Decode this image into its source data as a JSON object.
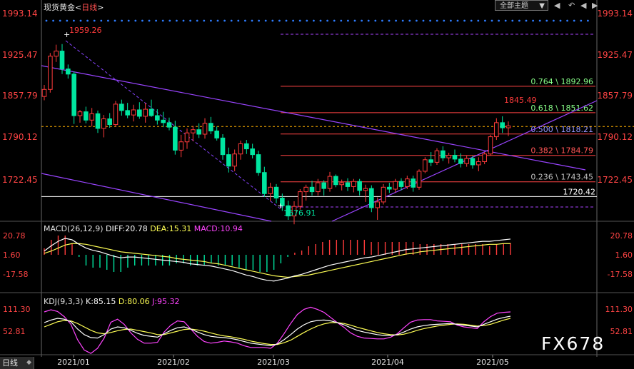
{
  "header": {
    "instrument": "现货黄金",
    "timeframe": "日线"
  },
  "toolbar": {
    "theme_label": "全部主题",
    "theme_arrow": "▼",
    "nav_first": "◀",
    "nav_back": "↶",
    "nav_prev": "◀",
    "nav_next": "▶"
  },
  "bottom_tab": {
    "label": "日线",
    "arrow": "◆"
  },
  "watermark": "FX678",
  "macd": {
    "title": "MACD(26,12,9)",
    "diff": "DIFF:20.78",
    "dea": "DEA:15.31",
    "macd": "MACD:10.94"
  },
  "kdj": {
    "title": "KDJ(9,3,3)",
    "k": "K:85.15",
    "d": "D:80.06",
    "j": "J:95.32"
  },
  "colors": {
    "up": "#ff3b3b",
    "down": "#00e6a0",
    "diff": "#ffffff",
    "dea": "#ffff55",
    "macd_pos": "#ff3b3b",
    "macd_neg": "#00e6a0",
    "k": "#ffffff",
    "d": "#ffff55",
    "j": "#ff44ff",
    "trend": "#9944ff",
    "fib": "#cc3333",
    "current": "#ffb000"
  },
  "chart_data": {
    "type": "candlestick",
    "price_axis_labels": [
      "1993.14",
      "1925.47",
      "1857.79",
      "1790.12",
      "1722.45"
    ],
    "time_axis_labels": [
      "2021/01",
      "2021/02",
      "2021/03",
      "2021/04",
      "2021/05"
    ],
    "ylim": [
      1665,
      2000
    ],
    "annotations": {
      "high": "1959.26",
      "low": "1676.91",
      "recent_high": "1845.49",
      "level_line": "1720.42"
    },
    "fibonacci": [
      {
        "label": "0.764 \\ 1892.96",
        "value": 1892.96,
        "color": "#88ff88"
      },
      {
        "label": "0.618 \\ 1851.62",
        "value": 1851.62,
        "color": "#88ff88"
      },
      {
        "label": "0.500 \\ 1818.21",
        "value": 1818.21,
        "color": "#9999ff"
      },
      {
        "label": "0.382 \\ 1784.79",
        "value": 1784.79,
        "color": "#ff5555"
      },
      {
        "label": "0.236 \\ 1743.45",
        "value": 1743.45,
        "color": "#c0c0c0"
      }
    ],
    "current_price": 1830,
    "candles": [
      [
        1877,
        1895,
        1871,
        1888
      ],
      [
        1888,
        1945,
        1883,
        1940
      ],
      [
        1940,
        1958,
        1931,
        1948
      ],
      [
        1948,
        1959,
        1912,
        1920
      ],
      [
        1920,
        1927,
        1905,
        1912
      ],
      [
        1912,
        1916,
        1834,
        1847
      ],
      [
        1847,
        1856,
        1836,
        1853
      ],
      [
        1853,
        1861,
        1835,
        1840
      ],
      [
        1840,
        1859,
        1830,
        1850
      ],
      [
        1850,
        1855,
        1820,
        1827
      ],
      [
        1827,
        1848,
        1813,
        1842
      ],
      [
        1842,
        1851,
        1828,
        1833
      ],
      [
        1833,
        1870,
        1830,
        1865
      ],
      [
        1865,
        1872,
        1847,
        1855
      ],
      [
        1855,
        1867,
        1843,
        1848
      ],
      [
        1848,
        1864,
        1838,
        1856
      ],
      [
        1856,
        1868,
        1842,
        1846
      ],
      [
        1846,
        1867,
        1836,
        1857
      ],
      [
        1857,
        1872,
        1845,
        1847
      ],
      [
        1847,
        1857,
        1833,
        1840
      ],
      [
        1840,
        1853,
        1829,
        1836
      ],
      [
        1836,
        1844,
        1824,
        1829
      ],
      [
        1829,
        1839,
        1786,
        1793
      ],
      [
        1793,
        1817,
        1782,
        1806
      ],
      [
        1806,
        1827,
        1795,
        1820
      ],
      [
        1820,
        1831,
        1807,
        1825
      ],
      [
        1825,
        1835,
        1812,
        1818
      ],
      [
        1818,
        1843,
        1811,
        1835
      ],
      [
        1835,
        1845,
        1818,
        1823
      ],
      [
        1823,
        1830,
        1808,
        1812
      ],
      [
        1812,
        1818,
        1778,
        1786
      ],
      [
        1786,
        1797,
        1758,
        1768
      ],
      [
        1768,
        1794,
        1760,
        1787
      ],
      [
        1787,
        1808,
        1778,
        1803
      ],
      [
        1803,
        1809,
        1787,
        1795
      ],
      [
        1795,
        1803,
        1780,
        1786
      ],
      [
        1786,
        1792,
        1753,
        1758
      ],
      [
        1758,
        1767,
        1720,
        1725
      ],
      [
        1725,
        1742,
        1713,
        1735
      ],
      [
        1735,
        1740,
        1710,
        1718
      ],
      [
        1718,
        1725,
        1698,
        1706
      ],
      [
        1706,
        1714,
        1684,
        1690
      ],
      [
        1690,
        1713,
        1677,
        1705
      ],
      [
        1705,
        1732,
        1700,
        1728
      ],
      [
        1728,
        1739,
        1714,
        1735
      ],
      [
        1735,
        1745,
        1722,
        1728
      ],
      [
        1728,
        1748,
        1722,
        1742
      ],
      [
        1742,
        1746,
        1722,
        1733
      ],
      [
        1733,
        1759,
        1728,
        1752
      ],
      [
        1752,
        1755,
        1735,
        1739
      ],
      [
        1739,
        1747,
        1730,
        1742
      ],
      [
        1742,
        1749,
        1729,
        1736
      ],
      [
        1736,
        1748,
        1727,
        1744
      ],
      [
        1744,
        1748,
        1722,
        1730
      ],
      [
        1730,
        1739,
        1712,
        1733
      ],
      [
        1733,
        1738,
        1696,
        1703
      ],
      [
        1703,
        1719,
        1684,
        1712
      ],
      [
        1712,
        1740,
        1708,
        1735
      ],
      [
        1735,
        1742,
        1726,
        1732
      ],
      [
        1732,
        1748,
        1727,
        1744
      ],
      [
        1744,
        1749,
        1730,
        1736
      ],
      [
        1736,
        1753,
        1732,
        1748
      ],
      [
        1748,
        1753,
        1728,
        1735
      ],
      [
        1735,
        1763,
        1731,
        1760
      ],
      [
        1760,
        1782,
        1757,
        1778
      ],
      [
        1778,
        1790,
        1768,
        1774
      ],
      [
        1774,
        1796,
        1770,
        1792
      ],
      [
        1792,
        1799,
        1776,
        1781
      ],
      [
        1781,
        1789,
        1772,
        1785
      ],
      [
        1785,
        1794,
        1774,
        1779
      ],
      [
        1779,
        1788,
        1766,
        1772
      ],
      [
        1772,
        1785,
        1767,
        1780
      ],
      [
        1780,
        1784,
        1764,
        1770
      ],
      [
        1770,
        1782,
        1760,
        1775
      ],
      [
        1775,
        1790,
        1771,
        1787
      ],
      [
        1787,
        1817,
        1784,
        1814
      ],
      [
        1814,
        1843,
        1809,
        1836
      ],
      [
        1836,
        1846,
        1820,
        1828
      ],
      [
        1828,
        1838,
        1815,
        1831
      ]
    ],
    "macd_series": {
      "diff": [
        5,
        12,
        18,
        22,
        20,
        14,
        9,
        6,
        4,
        1,
        -2,
        -4,
        -3,
        -3,
        -4,
        -5,
        -6,
        -7,
        -8,
        -9,
        -10,
        -12,
        -13,
        -14,
        -15,
        -17,
        -19,
        -21,
        -24,
        -27,
        -29,
        -32,
        -34,
        -35,
        -33,
        -31,
        -28,
        -26,
        -23,
        -20,
        -17,
        -14,
        -12,
        -10,
        -8,
        -6,
        -4,
        -3,
        -1,
        1,
        3,
        5,
        7,
        8,
        9,
        10,
        11,
        12,
        13,
        14,
        15,
        16,
        17,
        18,
        18,
        19,
        20,
        21
      ],
      "dea": [
        2,
        5,
        9,
        13,
        15,
        15,
        14,
        12,
        10,
        8,
        6,
        4,
        3,
        2,
        1,
        0,
        -1,
        -2,
        -3,
        -5,
        -6,
        -7,
        -8,
        -9,
        -11,
        -12,
        -14,
        -16,
        -18,
        -20,
        -22,
        -24,
        -26,
        -28,
        -29,
        -30,
        -29,
        -28,
        -27,
        -25,
        -23,
        -21,
        -19,
        -17,
        -15,
        -13,
        -11,
        -9,
        -7,
        -5,
        -3,
        -1,
        1,
        2,
        4,
        5,
        6,
        7,
        8,
        9,
        10,
        11,
        12,
        13,
        14,
        14,
        15,
        15
      ],
      "macd": [
        6,
        14,
        18,
        18,
        10,
        -2,
        -10,
        -12,
        -12,
        -14,
        -16,
        -16,
        -12,
        -10,
        -10,
        -10,
        -10,
        -10,
        -10,
        -8,
        -8,
        -10,
        -10,
        -10,
        -8,
        -10,
        -10,
        -10,
        -12,
        -14,
        -14,
        -16,
        -16,
        -14,
        -8,
        -2,
        2,
        4,
        8,
        10,
        12,
        14,
        14,
        14,
        14,
        14,
        14,
        12,
        12,
        12,
        12,
        12,
        12,
        12,
        10,
        10,
        10,
        10,
        10,
        10,
        10,
        10,
        10,
        10,
        8,
        10,
        10,
        11
      ]
    },
    "kdj_series": {
      "k": [
        70,
        76,
        80,
        78,
        72,
        55,
        42,
        35,
        34,
        42,
        55,
        60,
        58,
        52,
        45,
        40,
        38,
        36,
        44,
        52,
        58,
        60,
        55,
        48,
        42,
        38,
        36,
        35,
        33,
        30,
        26,
        22,
        20,
        18,
        16,
        20,
        30,
        42,
        55,
        65,
        72,
        75,
        76,
        74,
        70,
        65,
        58,
        52,
        48,
        45,
        42,
        40,
        40,
        42,
        48,
        55,
        60,
        63,
        65,
        66,
        67,
        68,
        66,
        64,
        62,
        60,
        66,
        72,
        78,
        82,
        85
      ],
      "d": [
        60,
        66,
        72,
        75,
        74,
        68,
        60,
        52,
        46,
        44,
        47,
        51,
        54,
        55,
        52,
        49,
        46,
        42,
        42,
        46,
        50,
        54,
        55,
        53,
        50,
        46,
        42,
        39,
        37,
        34,
        31,
        27,
        24,
        21,
        19,
        19,
        23,
        29,
        38,
        47,
        55,
        62,
        67,
        70,
        70,
        68,
        64,
        59,
        55,
        51,
        47,
        44,
        42,
        41,
        43,
        47,
        52,
        56,
        59,
        62,
        64,
        66,
        67,
        66,
        64,
        62,
        63,
        66,
        71,
        76,
        80
      ],
      "j": [
        95,
        100,
        96,
        84,
        66,
        30,
        6,
        -2,
        10,
        34,
        71,
        78,
        66,
        46,
        31,
        22,
        22,
        24,
        48,
        64,
        74,
        72,
        55,
        38,
        26,
        22,
        24,
        27,
        25,
        22,
        16,
        12,
        12,
        12,
        10,
        22,
        44,
        68,
        89,
        101,
        106,
        101,
        94,
        82,
        70,
        59,
        46,
        38,
        34,
        33,
        32,
        32,
        36,
        44,
        58,
        71,
        76,
        77,
        77,
        74,
        73,
        72,
        64,
        60,
        58,
        56,
        72,
        84,
        92,
        94,
        95
      ]
    }
  }
}
